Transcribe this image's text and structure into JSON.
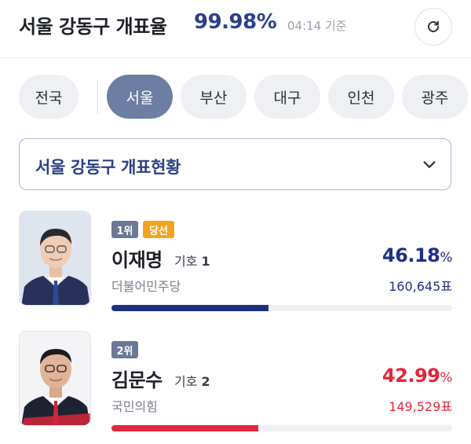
{
  "header": {
    "title": "서울 강동구 개표율",
    "rate": "99.98%",
    "time": "04:14 기준",
    "refresh_icon": "refresh-icon"
  },
  "regions": {
    "tabs": [
      "전국",
      "서울",
      "부산",
      "대구",
      "인천",
      "광주"
    ],
    "active": "서울"
  },
  "dropdown": {
    "label": "서울 강동구 개표현황",
    "icon": "chevron-down-icon"
  },
  "candidates": [
    {
      "rank": "1위",
      "status": "당선",
      "name": "이재명",
      "number_prefix": "기호",
      "number": "1",
      "party": "더불어민주당",
      "percent": "46.18",
      "percent_unit": "%",
      "votes": "160,645표",
      "share": 0.4618,
      "color": "#1f2f86"
    },
    {
      "rank": "2위",
      "name": "김문수",
      "number_prefix": "기호",
      "number": "2",
      "party": "국민의힘",
      "percent": "42.99",
      "percent_unit": "%",
      "votes": "149,529표",
      "share": 0.4299,
      "color": "#e3263b"
    }
  ],
  "colors": {
    "accent": "#2c3f8a",
    "active_tab": "#6d7ea3",
    "elected_badge": "#f5a21c",
    "rank_badge": "#6b7896"
  }
}
